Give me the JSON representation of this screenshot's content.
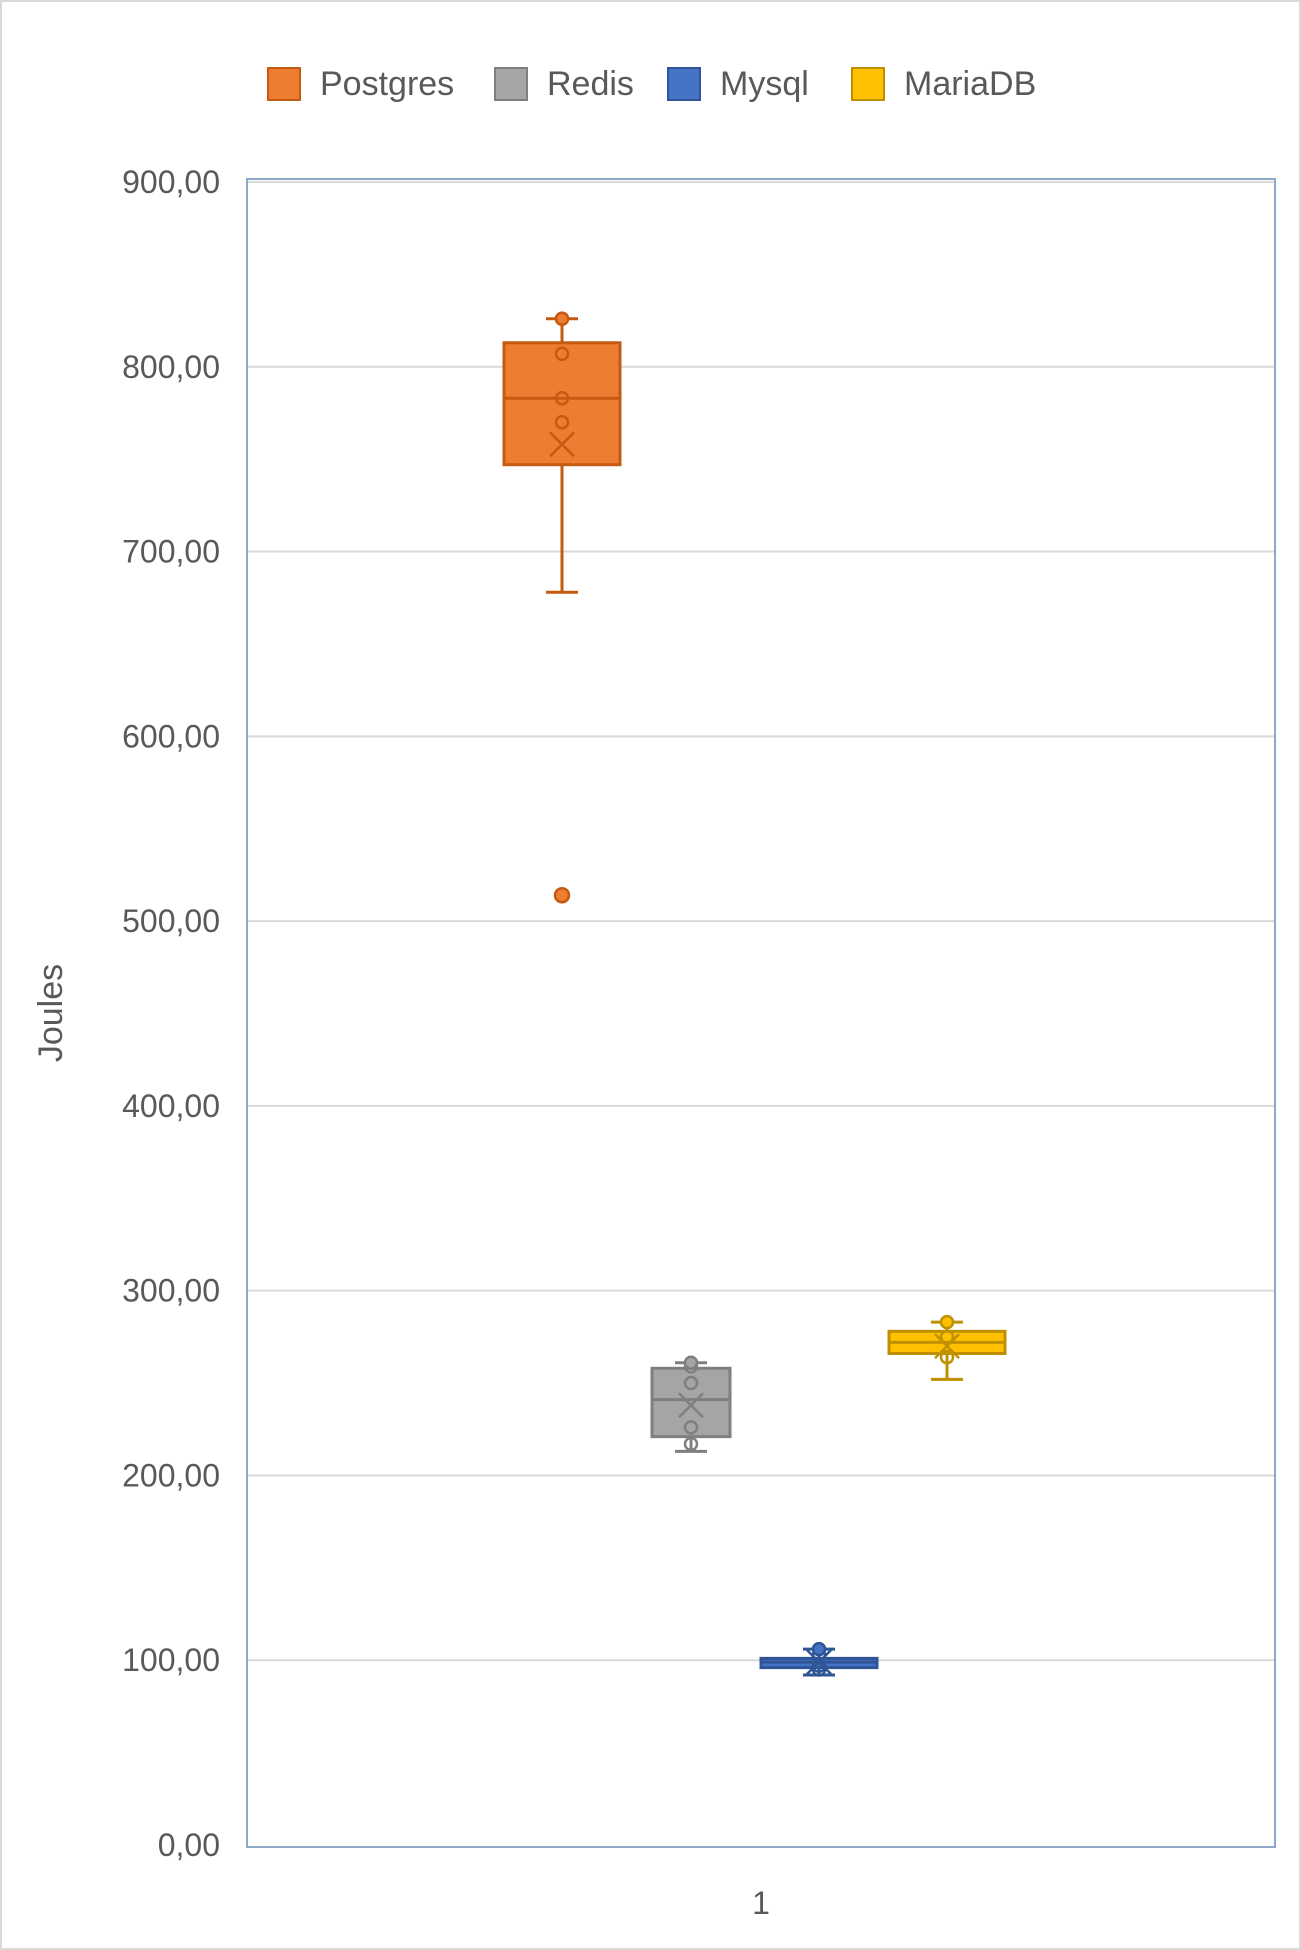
{
  "chart_data": {
    "type": "box",
    "title": "",
    "xlabel": "",
    "ylabel": "Joules",
    "categories": [
      "1"
    ],
    "ylim": [
      0,
      900
    ],
    "yticks": [
      0,
      100,
      200,
      300,
      400,
      500,
      600,
      700,
      800,
      900
    ],
    "ytick_labels": [
      "0,00",
      "100,00",
      "200,00",
      "300,00",
      "400,00",
      "500,00",
      "600,00",
      "700,00",
      "800,00",
      "900,00"
    ],
    "grid": true,
    "legend_position": "top",
    "series": [
      {
        "name": "Postgres",
        "color": "#ED7D31",
        "stroke": "#C55A11",
        "whisker_low": 678,
        "q1": 747,
        "median": 783,
        "q3": 813,
        "whisker_high": 826,
        "mean": 758,
        "points": [
          826,
          807,
          783,
          770
        ],
        "outliers": [
          514
        ]
      },
      {
        "name": "Redis",
        "color": "#A5A5A5",
        "stroke": "#7F7F7F",
        "whisker_low": 213,
        "q1": 221,
        "median": 241,
        "q3": 258,
        "whisker_high": 261,
        "mean": 238,
        "points": [
          259,
          250,
          226,
          217
        ],
        "outliers": []
      },
      {
        "name": "Mysql",
        "color": "#4472C4",
        "stroke": "#2F5597",
        "whisker_low": 92,
        "q1": 96,
        "median": 99,
        "q3": 101,
        "whisker_high": 106,
        "mean": 99,
        "points": [
          103,
          97,
          95
        ],
        "outliers": []
      },
      {
        "name": "MariaDB",
        "color": "#FFC000",
        "stroke": "#BF9000",
        "whisker_low": 252,
        "q1": 266,
        "median": 272,
        "q3": 278,
        "whisker_high": 283,
        "mean": 270,
        "points": [
          275,
          264
        ],
        "outliers": []
      }
    ]
  }
}
